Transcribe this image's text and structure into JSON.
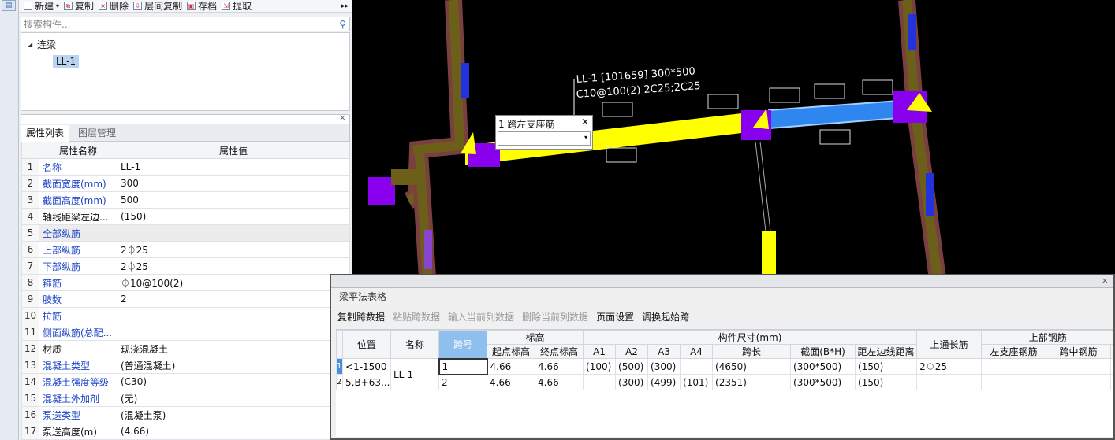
{
  "toolbar": {
    "new": "新建",
    "copy": "复制",
    "delete": "删除",
    "floor_copy": "层间复制",
    "save": "存档",
    "extract": "提取"
  },
  "search": {
    "placeholder": "搜索构件..."
  },
  "tree": {
    "root": "连梁",
    "child": "LL-1"
  },
  "props": {
    "tabs": [
      "属性列表",
      "图层管理"
    ],
    "col_name": "属性名称",
    "col_value": "属性值",
    "rows": [
      {
        "no": "1",
        "name": "名称",
        "value": "LL-1"
      },
      {
        "no": "2",
        "name": "截面宽度(mm)",
        "value": "300"
      },
      {
        "no": "3",
        "name": "截面高度(mm)",
        "value": "500"
      },
      {
        "no": "4",
        "name": "轴线距梁左边...",
        "value": "(150)"
      },
      {
        "no": "5",
        "name": "全部纵筋",
        "value": ""
      },
      {
        "no": "6",
        "name": "上部纵筋",
        "value": "2⏀25"
      },
      {
        "no": "7",
        "name": "下部纵筋",
        "value": "2⏀25"
      },
      {
        "no": "8",
        "name": "箍筋",
        "value": "⏀10@100(2)"
      },
      {
        "no": "9",
        "name": "肢数",
        "value": "2"
      },
      {
        "no": "10",
        "name": "拉筋",
        "value": ""
      },
      {
        "no": "11",
        "name": "侧面纵筋(总配...",
        "value": ""
      },
      {
        "no": "12",
        "name": "材质",
        "value": "现浇混凝土"
      },
      {
        "no": "13",
        "name": "混凝土类型",
        "value": "(普通混凝土)"
      },
      {
        "no": "14",
        "name": "混凝土强度等级",
        "value": "(C30)"
      },
      {
        "no": "15",
        "name": "混凝土外加剂",
        "value": "(无)"
      },
      {
        "no": "16",
        "name": "泵送类型",
        "value": "(混凝土泵)"
      },
      {
        "no": "17",
        "name": "泵送高度(m)",
        "value": "(4.66)"
      }
    ]
  },
  "drawing": {
    "label_line1": "LL-1 [101659] 300*500",
    "label_line2": "C10@100(2) 2C25;2C25"
  },
  "popup": {
    "title": "1 跨左支座筋",
    "close": "✕",
    "value": ""
  },
  "beam_table": {
    "title": "梁平法表格",
    "toolbar": [
      "复制跨数据",
      "粘贴跨数据",
      "输入当前列数据",
      "删除当前列数据",
      "页面设置",
      "调换起始跨"
    ],
    "headers": {
      "position": "位置",
      "name": "名称",
      "span_no": "跨号",
      "elevation": "标高",
      "elev_start": "起点标高",
      "elev_end": "终点标高",
      "size": "构件尺寸(mm)",
      "a1": "A1",
      "a2": "A2",
      "a3": "A3",
      "a4": "A4",
      "span_len": "跨长",
      "section": "截面(B*H)",
      "dist_left": "距左边线距离",
      "top_through": "上通长筋",
      "top_rebar": "上部钢筋",
      "left_support": "左支座钢筋",
      "mid_span": "跨中钢筋"
    },
    "rows": [
      {
        "rowno": "1",
        "position": "<1-1500",
        "name": "LL-1",
        "span": "1",
        "elev_start": "4.66",
        "elev_end": "4.66",
        "a1": "(100)",
        "a2": "(500)",
        "a3": "(300)",
        "a4": "",
        "span_len": "(4650)",
        "section": "(300*500)",
        "dist": "(150)",
        "top_through": "2⏀25"
      },
      {
        "rowno": "2",
        "position": "5,B+63...",
        "span": "2",
        "elev_start": "4.66",
        "elev_end": "4.66",
        "a1": "",
        "a2": "(300)",
        "a3": "(499)",
        "a4": "(101)",
        "span_len": "(2351)",
        "section": "(300*500)",
        "dist": "(150)",
        "top_through": ""
      }
    ]
  }
}
